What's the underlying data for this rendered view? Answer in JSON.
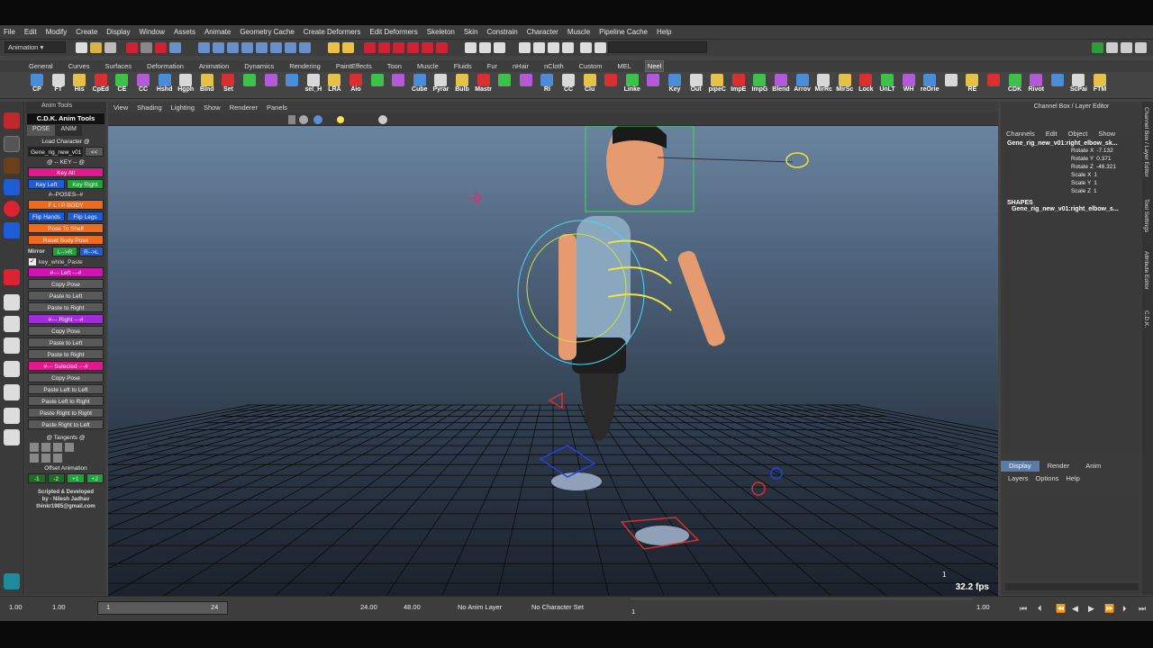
{
  "menubar": [
    "File",
    "Edit",
    "Modify",
    "Create",
    "Display",
    "Window",
    "Assets",
    "Animate",
    "Geometry Cache",
    "Create Deformers",
    "Edit Deformers",
    "Skeleton",
    "Skin",
    "Constrain",
    "Character",
    "Muscle",
    "Pipeline Cache",
    "Help"
  ],
  "status": {
    "mode": "Animation"
  },
  "shelf_tabs": [
    "General",
    "Curves",
    "Surfaces",
    "Deformation",
    "Animation",
    "Dynamics",
    "Rendering",
    "PaintEffects",
    "Toon",
    "Muscle",
    "Fluids",
    "Fur",
    "nHair",
    "nCloth",
    "Custom",
    "MEL",
    "Neel"
  ],
  "shelf_active": "Neel",
  "shelf_buttons": [
    "CP",
    "FT",
    "His",
    "CpEd",
    "CE",
    "CC",
    "Hshd",
    "Hgph",
    "Blnd",
    "Set",
    "",
    "",
    "",
    "sel_H",
    "LRA",
    "Aio",
    "",
    "",
    "Cube",
    "Pyrar",
    "Bulb",
    "Mastr",
    "",
    "",
    "RI",
    "CC",
    "Clu",
    "",
    "Linke",
    "",
    "Key",
    "Out",
    "pipeC",
    "ImpE",
    "ImpG",
    "Blend",
    "Arrov",
    "MirRc",
    "MirSc",
    "Lock",
    "UnLT",
    "WH",
    "reOrie",
    "",
    "RE",
    "",
    "CDK",
    "Rivot",
    "",
    "ScPai",
    "FTM"
  ],
  "anim_panel": {
    "panel_title": "Anim Tools",
    "header": "C.D.K. Anim Tools",
    "tabs": [
      "POSE",
      "ANIM"
    ],
    "load_character": "Load Character @",
    "character_field": "Gene_rig_new_v01:",
    "character_btn": "<<",
    "key_label": "@ -- KEY -- @",
    "key_all": "Key All",
    "key_left": "Key Left",
    "key_right": "Key Right",
    "poses_label": "#--POSES--#",
    "flip_body": "F L I P  BODY",
    "flip_hands": "Flip Hands",
    "flip_legs": "Flip Legs",
    "pose_to_shelf": "Pose To Shelf",
    "reset_body": "Reset Body Pose",
    "mirror": "Mirror",
    "l_to_r": "L-->R",
    "r_to_l": "R-->L",
    "key_while_paste": "key_while_Paste",
    "left_header": "#--- Left ---#",
    "left_buttons": [
      "Copy Pose",
      "Paste to Left",
      "Paste to Right"
    ],
    "right_header": "#--- Right ---#",
    "right_buttons": [
      "Copy Pose",
      "Paste to Left",
      "Paste to Right"
    ],
    "selected_header": "#--- Selected ---#",
    "selected_buttons": [
      "Copy Pose",
      "Paste Left to Left",
      "Paste Left to Right",
      "Paste Right to Right",
      "Paste Right to Left"
    ],
    "tangents": "@ Tangents @",
    "offset_animation": "Offset Animation",
    "offset_buttons": [
      "-1",
      "-2",
      "+1",
      "+2"
    ],
    "credits": [
      "Scripted & Developed",
      "by - Nilesh Jadhav",
      "thinkr1985@gmail.com"
    ]
  },
  "viewport": {
    "menu": [
      "View",
      "Shading",
      "Lighting",
      "Show",
      "Renderer",
      "Panels"
    ],
    "fps": "32.2 fps",
    "frame": "1"
  },
  "channel_box": {
    "title": "Channel Box / Layer Editor",
    "menu": [
      "Channels",
      "Edit",
      "Object",
      "Show"
    ],
    "object": "Gene_rig_new_v01:right_elbow_sk...",
    "attrs": [
      {
        "name": "Rotate X",
        "value": "-7.132"
      },
      {
        "name": "Rotate Y",
        "value": "0.371"
      },
      {
        "name": "Rotate Z",
        "value": "-46.321"
      },
      {
        "name": "Scale X",
        "value": "1"
      },
      {
        "name": "Scale Y",
        "value": "1"
      },
      {
        "name": "Scale Z",
        "value": "1"
      }
    ],
    "shapes_label": "SHAPES",
    "shape": "Gene_rig_new_v01:right_elbow_s..."
  },
  "layer_editor": {
    "tabs": [
      "Display",
      "Render",
      "Anim"
    ],
    "menu": [
      "Layers",
      "Options",
      "Help"
    ]
  },
  "side_tabs": [
    "Channel Box / Layer Editor",
    "Tool Settings",
    "Attribute Editor",
    "C.D.K."
  ],
  "timeline": {
    "start": "1.00",
    "start2": "1.00",
    "range_start": "1",
    "range_end": "24",
    "end": "24.00",
    "end2": "48.00",
    "anim_layer": "No Anim Layer",
    "char_set": "No Character Set",
    "frame_marker": "1",
    "current": "1.00"
  }
}
